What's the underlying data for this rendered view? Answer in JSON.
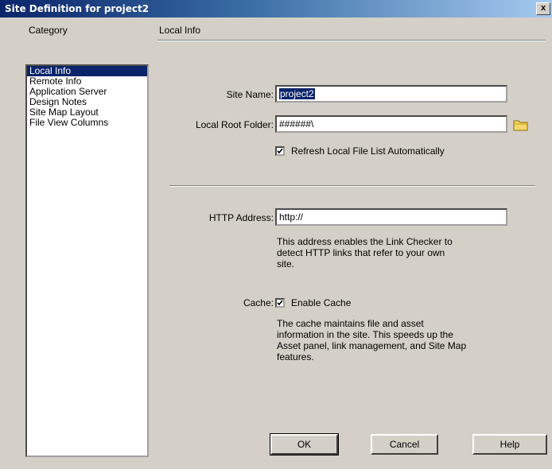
{
  "window": {
    "title": "Site Definition for project2",
    "close_glyph": "x"
  },
  "category": {
    "label": "Category",
    "items": [
      {
        "label": "Local Info",
        "selected": true
      },
      {
        "label": "Remote Info"
      },
      {
        "label": "Application Server"
      },
      {
        "label": "Design Notes"
      },
      {
        "label": "Site Map Layout"
      },
      {
        "label": "File View Columns"
      }
    ]
  },
  "panel": {
    "section_title": "Local Info",
    "site_name": {
      "label": "Site Name:",
      "value": "project2"
    },
    "local_root": {
      "label": "Local Root Folder:",
      "value": "######\\"
    },
    "refresh": {
      "label": "Refresh Local File List Automatically",
      "checked": true
    },
    "http": {
      "label": "HTTP Address:",
      "value": "http://",
      "desc_lines": [
        "This address enables the Link Checker to",
        "detect HTTP links that refer to your own",
        "site."
      ]
    },
    "cache": {
      "label": "Cache:",
      "checkbox_label": "Enable Cache",
      "checked": true,
      "desc_lines": [
        "The cache maintains file and asset",
        "information in the site.  This speeds up the",
        "Asset panel, link management, and Site Map",
        "features."
      ]
    }
  },
  "buttons": {
    "ok": "OK",
    "cancel": "Cancel",
    "help": "Help"
  },
  "colors": {
    "selection": "#0a246a",
    "dialog_bg": "#d4d0c8",
    "folder": "#f5d76e"
  },
  "icons": {
    "folder": "folder-icon",
    "checkmark": "checkmark-icon",
    "close": "close-icon"
  }
}
